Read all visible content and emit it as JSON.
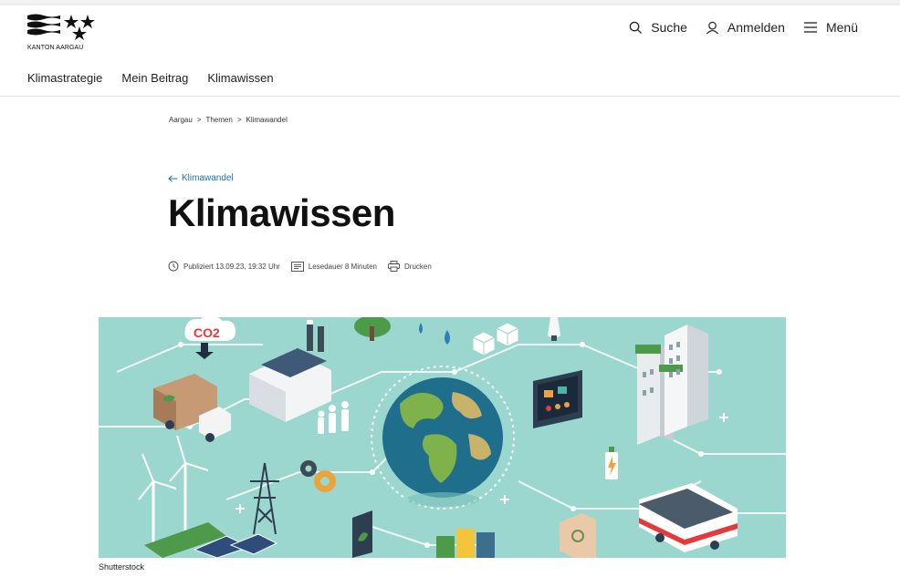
{
  "header": {
    "logo_text": "KANTON AARGAU",
    "search_label": "Suche",
    "login_label": "Anmelden",
    "menu_label": "Menü"
  },
  "subnav": {
    "items": [
      {
        "label": "Klimastrategie"
      },
      {
        "label": "Mein Beitrag"
      },
      {
        "label": "Klimawissen"
      }
    ]
  },
  "breadcrumb": {
    "items": [
      "Aargau",
      "Themen",
      "Klimawandel"
    ],
    "separator": ">"
  },
  "back_link": {
    "label": "Klimawandel"
  },
  "page_title": "Klimawissen",
  "meta": {
    "published": "Publiziert 13.09.23, 19:32 Uhr",
    "reading_time": "Lesedauer 8 Minuten",
    "print_label": "Drucken"
  },
  "hero": {
    "caption": "Shutterstock",
    "co2_label": "CO2"
  },
  "colors": {
    "link_blue": "#1f6fb5",
    "hero_bg": "#9bd6cf",
    "earth_ocean": "#1f6e8c",
    "earth_land": "#7fb24a"
  }
}
